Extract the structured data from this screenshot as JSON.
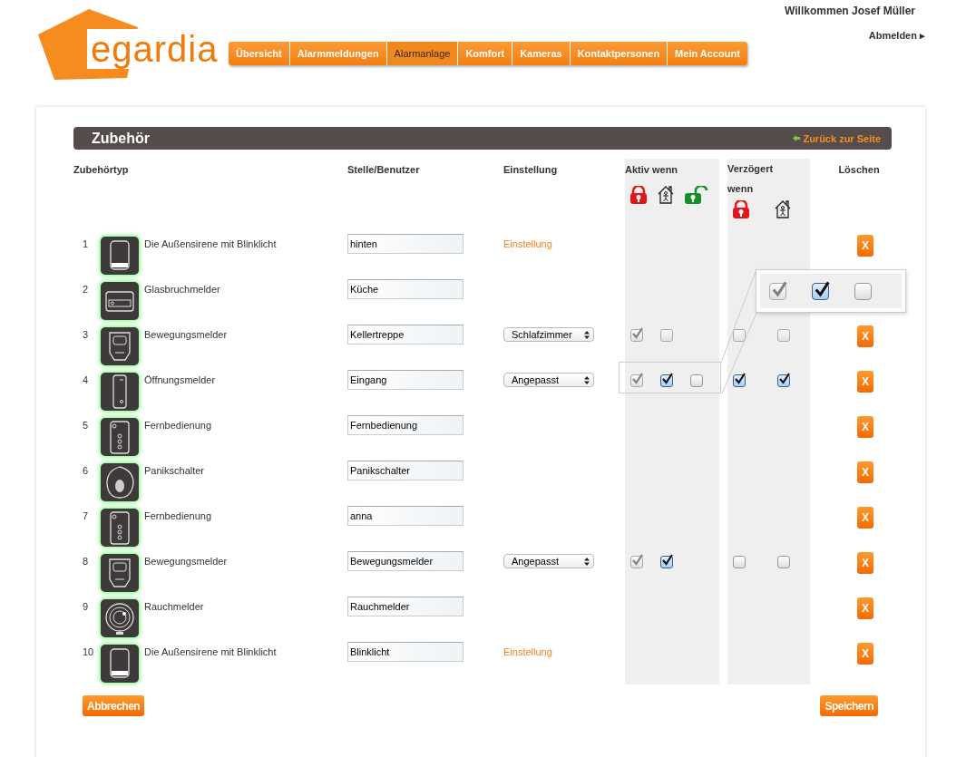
{
  "logo": {
    "text": "egardia"
  },
  "nav": [
    {
      "label": "Übersicht",
      "selected": false
    },
    {
      "label": "Alarmmeldungen",
      "selected": false
    },
    {
      "label": "Alarmanlage",
      "selected": true
    },
    {
      "label": "Komfort",
      "selected": false
    },
    {
      "label": "Kameras",
      "selected": false
    },
    {
      "label": "Kontaktpersonen",
      "selected": false
    },
    {
      "label": "Mein Account",
      "selected": false
    }
  ],
  "user": {
    "welcome": "Willkommen Josef Müller",
    "logout": "Abmelden ▸"
  },
  "panel": {
    "title": "Zubehör",
    "back_link": "Zurück zur Seite"
  },
  "columns": {
    "type": "Zubehörtyp",
    "user": "Stelle/Benutzer",
    "setting": "Einstellung",
    "active": {
      "label": "Aktiv wenn",
      "modes": [
        {
          "kind": "armed"
        },
        {
          "kind": "home"
        },
        {
          "kind": "disarmed"
        }
      ]
    },
    "delayed": {
      "label": "Verzögert wenn",
      "modes": [
        {
          "kind": "armed"
        },
        {
          "kind": "home"
        }
      ]
    },
    "delete": "Löschen"
  },
  "rows": [
    {
      "index": "1",
      "kind": "siren",
      "name": "Die Außensirene mit Blinklicht",
      "location": "hinten",
      "setting": {
        "kind": "link",
        "text": "Einstellung"
      },
      "active": [],
      "delayed": [],
      "delete": "X"
    },
    {
      "index": "2",
      "kind": "glass",
      "name": "Glasbruchmelder",
      "location": "Küche",
      "setting": {
        "kind": "none"
      },
      "active": [],
      "delayed": []
    },
    {
      "index": "3",
      "kind": "motion",
      "name": "Bewegungsmelder",
      "location": "Kellertreppe",
      "setting": {
        "kind": "select",
        "text": "Schlafzimmer"
      },
      "active": [
        {
          "checked": true,
          "disabled": true
        },
        {
          "checked": false,
          "disabled": true
        }
      ],
      "delayed": [
        {
          "checked": false,
          "disabled": true
        },
        {
          "checked": false,
          "disabled": true
        }
      ],
      "delete": "X"
    },
    {
      "index": "4",
      "kind": "contact",
      "name": "Öffnungsmelder",
      "location": "Eingang",
      "setting": {
        "kind": "select",
        "text": "Angepasst"
      },
      "active": [
        {
          "checked": true,
          "disabled": true
        },
        {
          "checked": true,
          "disabled": false
        },
        {
          "checked": false,
          "disabled": false
        }
      ],
      "delayed": [
        {
          "checked": true,
          "disabled": false
        },
        {
          "checked": true,
          "disabled": false
        }
      ],
      "delete": "X"
    },
    {
      "index": "5",
      "kind": "remote",
      "name": "Fernbedienung",
      "location": "Fernbedienung",
      "setting": {
        "kind": "none"
      },
      "active": [],
      "delayed": [],
      "delete": "X"
    },
    {
      "index": "6",
      "kind": "panic",
      "name": "Panikschalter",
      "location": "Panikschalter",
      "setting": {
        "kind": "none"
      },
      "active": [],
      "delayed": [],
      "delete": "X"
    },
    {
      "index": "7",
      "kind": "remote",
      "name": "Fernbedienung",
      "location": "anna",
      "setting": {
        "kind": "none"
      },
      "active": [],
      "delayed": [],
      "delete": "X"
    },
    {
      "index": "8",
      "kind": "motion",
      "name": "Bewegungsmelder",
      "location": "Bewegungsmelder",
      "setting": {
        "kind": "select",
        "text": "Angepasst"
      },
      "active": [
        {
          "checked": true,
          "disabled": true
        },
        {
          "checked": true,
          "disabled": false
        }
      ],
      "delayed": [
        {
          "checked": false,
          "disabled": false
        },
        {
          "checked": false,
          "disabled": false
        }
      ],
      "delete": "X"
    },
    {
      "index": "9",
      "kind": "smoke",
      "name": "Rauchmelder",
      "location": "Rauchmelder",
      "setting": {
        "kind": "none"
      },
      "active": [],
      "delayed": [],
      "delete": "X"
    },
    {
      "index": "10",
      "kind": "siren",
      "name": "Die Außensirene mit Blinklicht",
      "location": "Blinklicht",
      "setting": {
        "kind": "link",
        "text": "Einstellung"
      },
      "active": [],
      "delayed": [],
      "delete": "X"
    }
  ],
  "magnifier": {
    "checkboxes": [
      {
        "checked": true,
        "disabled": true
      },
      {
        "checked": true,
        "disabled": false
      },
      {
        "checked": false,
        "disabled": false
      }
    ]
  },
  "buttons": {
    "cancel": "Abbrechen",
    "save": "Speichern"
  }
}
